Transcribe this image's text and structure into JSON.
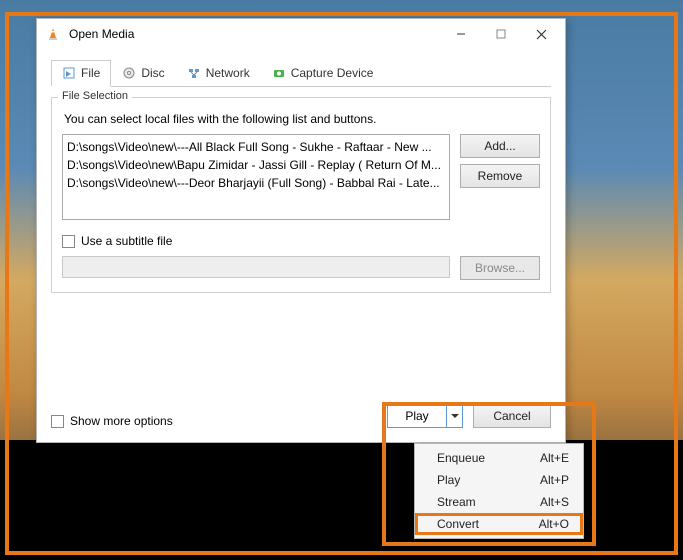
{
  "window": {
    "title": "Open Media",
    "controls": {
      "minimize": "—",
      "maximize": "▢",
      "close": "✕"
    }
  },
  "tabs": {
    "file": "File",
    "disc": "Disc",
    "network": "Network",
    "capture": "Capture Device"
  },
  "fileSelection": {
    "legend": "File Selection",
    "hint": "You can select local files with the following list and buttons.",
    "files": [
      "D:\\songs\\Video\\new\\---All Black Full Song - Sukhe - Raftaar -  New ...",
      "D:\\songs\\Video\\new\\Bapu Zimidar - Jassi Gill - Replay ( Return Of M...",
      "D:\\songs\\Video\\new\\---Deor Bharjayii (Full Song) - Babbal Rai - Late..."
    ],
    "addLabel": "Add...",
    "removeLabel": "Remove"
  },
  "subtitle": {
    "checkboxLabel": "Use a subtitle file",
    "browseLabel": "Browse..."
  },
  "showMoreLabel": "Show more options",
  "buttons": {
    "play": "Play",
    "cancel": "Cancel"
  },
  "menu": {
    "items": [
      {
        "label": "Enqueue",
        "shortcut": "Alt+E"
      },
      {
        "label": "Play",
        "shortcut": "Alt+P"
      },
      {
        "label": "Stream",
        "shortcut": "Alt+S"
      },
      {
        "label": "Convert",
        "shortcut": "Alt+O"
      }
    ]
  }
}
